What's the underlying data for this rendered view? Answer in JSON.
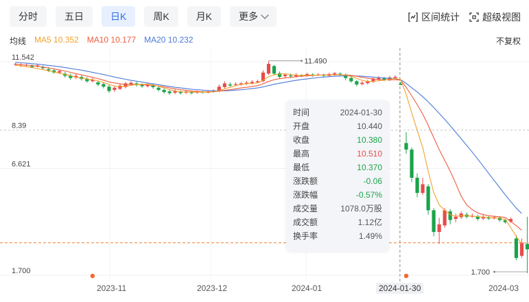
{
  "tabs": [
    {
      "label": "分时",
      "active": false
    },
    {
      "label": "五日",
      "active": false
    },
    {
      "label": "日K",
      "active": true
    },
    {
      "label": "周K",
      "active": false
    },
    {
      "label": "月K",
      "active": false
    },
    {
      "label": "更多",
      "active": false
    }
  ],
  "tools": {
    "range_stats": "区间统计",
    "super_view": "超级视图"
  },
  "indicators": {
    "title": "均线",
    "ma5": "MA5 10.352",
    "ma10": "MA10 10.177",
    "ma20": "MA20 10.232"
  },
  "adjust_label": "不复权",
  "tooltip": {
    "rows": [
      {
        "k": "时间",
        "v": "2024-01-30",
        "c": ""
      },
      {
        "k": "开盘",
        "v": "10.440",
        "c": ""
      },
      {
        "k": "收盘",
        "v": "10.380",
        "c": "g"
      },
      {
        "k": "最高",
        "v": "10.510",
        "c": "r"
      },
      {
        "k": "最低",
        "v": "10.370",
        "c": "g"
      },
      {
        "k": "涨跌额",
        "v": "-0.06",
        "c": "g"
      },
      {
        "k": "涨跌幅",
        "v": "-0.57%",
        "c": "g"
      },
      {
        "k": "成交量",
        "v": "1078.0万股",
        "c": ""
      },
      {
        "k": "成交额",
        "v": "1.12亿",
        "c": ""
      },
      {
        "k": "换手率",
        "v": "1.49%",
        "c": ""
      }
    ]
  },
  "x_axis": {
    "labels": [
      "2023-11",
      "2023-12",
      "2024-01",
      "2024-03"
    ],
    "highlight": "2024-01-30"
  },
  "colors": {
    "up": "#e84b4b",
    "down": "#1aa34a",
    "ma5": "#f0a22c",
    "ma10": "#ef5b3d",
    "ma20": "#4c78d8",
    "crosshair": "#f07b2c"
  },
  "chart_data": {
    "type": "candlestick",
    "y_ticks": [
      "11.542",
      "8.39",
      "6.621",
      "1.700"
    ],
    "ylim": [
      1.7,
      11.542
    ],
    "crosshair_price": "3.1",
    "annotations": {
      "high": "11.490",
      "low": "1.700"
    },
    "grid": true,
    "candles": [
      [
        11.32,
        11.35,
        11.4,
        11.25
      ],
      [
        11.3,
        11.32,
        11.38,
        11.2
      ],
      [
        11.28,
        11.3,
        11.36,
        11.22
      ],
      [
        11.25,
        11.2,
        11.32,
        11.15
      ],
      [
        11.22,
        11.28,
        11.35,
        11.18
      ],
      [
        11.2,
        11.15,
        11.28,
        11.1
      ],
      [
        11.1,
        11.05,
        11.2,
        10.98
      ],
      [
        11.05,
        10.95,
        11.12,
        10.9
      ],
      [
        10.95,
        11.02,
        11.08,
        10.88
      ],
      [
        10.9,
        10.8,
        10.98,
        10.72
      ],
      [
        10.82,
        10.7,
        10.9,
        10.62
      ],
      [
        10.72,
        10.8,
        10.88,
        10.65
      ],
      [
        10.75,
        10.65,
        10.82,
        10.58
      ],
      [
        10.66,
        10.55,
        10.74,
        10.48
      ],
      [
        10.55,
        10.62,
        10.7,
        10.5
      ],
      [
        10.5,
        10.4,
        10.58,
        10.32
      ],
      [
        10.42,
        10.3,
        10.5,
        10.22
      ],
      [
        10.3,
        10.1,
        10.38,
        10.02
      ],
      [
        10.15,
        10.25,
        10.32,
        10.05
      ],
      [
        10.2,
        10.35,
        10.42,
        10.15
      ],
      [
        10.28,
        10.45,
        10.52,
        10.22
      ],
      [
        10.4,
        10.48,
        10.55,
        10.35
      ],
      [
        10.45,
        10.38,
        10.52,
        10.3
      ],
      [
        10.38,
        10.32,
        10.45,
        10.25
      ],
      [
        10.32,
        10.4,
        10.48,
        10.26
      ],
      [
        10.35,
        10.28,
        10.42,
        10.2
      ],
      [
        10.25,
        10.15,
        10.32,
        10.08
      ],
      [
        10.15,
        10.05,
        10.22,
        9.98
      ],
      [
        10.08,
        10.0,
        10.15,
        9.92
      ],
      [
        10.02,
        10.1,
        10.18,
        9.95
      ],
      [
        10.05,
        10.0,
        10.12,
        9.94
      ],
      [
        10.02,
        10.08,
        10.15,
        9.96
      ],
      [
        10.05,
        10.0,
        10.12,
        9.95
      ],
      [
        10.02,
        10.06,
        10.12,
        9.97
      ],
      [
        10.05,
        10.02,
        10.1,
        9.98
      ],
      [
        10.02,
        10.08,
        10.14,
        9.99
      ],
      [
        10.08,
        10.12,
        10.18,
        10.02
      ],
      [
        10.1,
        10.3,
        10.4,
        10.05
      ],
      [
        10.28,
        10.45,
        10.55,
        10.22
      ],
      [
        10.4,
        10.35,
        10.5,
        10.3
      ],
      [
        10.38,
        10.42,
        10.5,
        10.33
      ],
      [
        10.4,
        10.45,
        10.52,
        10.35
      ],
      [
        10.42,
        10.48,
        10.56,
        10.38
      ],
      [
        10.46,
        10.52,
        10.6,
        10.4
      ],
      [
        10.5,
        10.55,
        10.62,
        10.45
      ],
      [
        10.55,
        10.95,
        11.05,
        10.5
      ],
      [
        10.9,
        11.35,
        11.49,
        10.85
      ],
      [
        11.25,
        10.9,
        11.3,
        10.82
      ],
      [
        10.92,
        10.75,
        11.0,
        10.68
      ],
      [
        10.78,
        10.85,
        10.92,
        10.7
      ],
      [
        10.82,
        10.78,
        10.9,
        10.7
      ],
      [
        10.78,
        10.85,
        10.92,
        10.72
      ],
      [
        10.82,
        10.8,
        10.88,
        10.74
      ],
      [
        10.8,
        10.88,
        10.94,
        10.76
      ],
      [
        10.86,
        10.82,
        10.92,
        10.76
      ],
      [
        10.82,
        10.86,
        10.92,
        10.78
      ],
      [
        10.84,
        10.8,
        10.9,
        10.74
      ],
      [
        10.8,
        10.88,
        10.94,
        10.76
      ],
      [
        10.86,
        10.92,
        10.98,
        10.8
      ],
      [
        10.9,
        10.85,
        10.96,
        10.8
      ],
      [
        10.86,
        10.7,
        10.9,
        10.6
      ],
      [
        10.7,
        10.55,
        10.75,
        10.48
      ],
      [
        10.55,
        10.4,
        10.6,
        10.32
      ],
      [
        10.42,
        10.48,
        10.55,
        10.36
      ],
      [
        10.46,
        10.55,
        10.62,
        10.4
      ],
      [
        10.52,
        10.65,
        10.72,
        10.48
      ],
      [
        10.62,
        10.7,
        10.78,
        10.56
      ],
      [
        10.68,
        10.6,
        10.75,
        10.55
      ],
      [
        10.6,
        10.72,
        10.8,
        10.56
      ],
      [
        10.7,
        10.75,
        10.82,
        10.66
      ],
      [
        10.44,
        10.38,
        10.51,
        10.37
      ],
      [
        7.7,
        7.4,
        8.2,
        7.2
      ],
      [
        7.4,
        6.1,
        7.5,
        5.9
      ],
      [
        6.1,
        5.4,
        6.3,
        5.2
      ],
      [
        5.4,
        5.8,
        6.1,
        5.3
      ],
      [
        5.7,
        4.6,
        5.8,
        4.4
      ],
      [
        4.6,
        3.6,
        4.7,
        3.4
      ],
      [
        3.6,
        3.95,
        4.25,
        3.05
      ],
      [
        3.9,
        4.6,
        4.7,
        3.8
      ],
      [
        4.55,
        4.15,
        4.65,
        3.95
      ],
      [
        4.2,
        4.3,
        4.45,
        4.05
      ],
      [
        4.28,
        4.45,
        4.55,
        4.2
      ],
      [
        4.4,
        4.3,
        4.5,
        4.22
      ],
      [
        4.3,
        4.35,
        4.45,
        4.25
      ],
      [
        4.32,
        4.2,
        4.4,
        4.12
      ],
      [
        4.22,
        4.3,
        4.38,
        4.15
      ],
      [
        4.28,
        4.22,
        4.35,
        4.15
      ],
      [
        4.22,
        4.28,
        4.35,
        4.18
      ],
      [
        4.26,
        4.15,
        4.32,
        4.08
      ],
      [
        4.15,
        4.05,
        4.22,
        3.98
      ],
      [
        4.08,
        4.2,
        4.26,
        4.02
      ],
      [
        3.3,
        2.4,
        3.45,
        2.3
      ],
      [
        2.5,
        3.1,
        3.3,
        2.4
      ],
      [
        3.05,
        2.8,
        4.3,
        1.7
      ]
    ],
    "ma5": [
      11.29,
      11.26,
      11.22,
      11.18,
      11.13,
      11.08,
      11.03,
      10.98,
      10.92,
      10.87,
      10.8,
      10.74,
      10.69,
      10.66,
      10.62,
      10.56,
      10.5,
      10.4,
      10.33,
      10.3,
      10.31,
      10.36,
      10.4,
      10.41,
      10.41,
      10.38,
      10.32,
      10.24,
      10.16,
      10.1,
      10.07,
      10.05,
      10.05,
      10.05,
      10.04,
      10.05,
      10.06,
      10.11,
      10.2,
      10.27,
      10.34,
      10.4,
      10.43,
      10.45,
      10.47,
      10.59,
      10.76,
      10.85,
      10.88,
      10.89,
      10.86,
      10.83,
      10.82,
      10.83,
      10.83,
      10.83,
      10.83,
      10.84,
      10.85,
      10.86,
      10.83,
      10.77,
      10.68,
      10.59,
      10.54,
      10.55,
      10.57,
      10.6,
      10.64,
      10.68,
      10.63,
      9.94,
      9.1,
      8.28,
      7.5,
      6.4,
      5.42,
      4.85,
      4.6,
      4.4,
      4.32,
      4.35,
      4.35,
      4.33,
      4.31,
      4.29,
      4.27,
      4.25,
      4.23,
      4.18,
      3.8,
      3.4,
      3.05
    ],
    "ma10": [
      11.33,
      11.31,
      11.29,
      11.27,
      11.24,
      11.2,
      11.16,
      11.12,
      11.07,
      11.02,
      10.96,
      10.9,
      10.84,
      10.79,
      10.73,
      10.67,
      10.6,
      10.52,
      10.47,
      10.43,
      10.4,
      10.4,
      10.4,
      10.39,
      10.38,
      10.36,
      10.33,
      10.29,
      10.24,
      10.2,
      10.16,
      10.13,
      10.1,
      10.08,
      10.06,
      10.06,
      10.07,
      10.09,
      10.13,
      10.16,
      10.2,
      10.24,
      10.27,
      10.31,
      10.35,
      10.43,
      10.54,
      10.62,
      10.67,
      10.7,
      10.73,
      10.76,
      10.78,
      10.8,
      10.81,
      10.83,
      10.84,
      10.85,
      10.85,
      10.85,
      10.84,
      10.82,
      10.78,
      10.73,
      10.69,
      10.66,
      10.63,
      10.61,
      10.61,
      10.62,
      10.6,
      10.27,
      9.88,
      9.47,
      9.04,
      8.52,
      7.95,
      7.4,
      6.9,
      6.4,
      5.84,
      5.24,
      4.85,
      4.63,
      4.48,
      4.4,
      4.35,
      4.32,
      4.3,
      4.27,
      4.09,
      3.89,
      3.68
    ],
    "ma20": [
      11.42,
      11.4,
      11.38,
      11.36,
      11.34,
      11.31,
      11.28,
      11.25,
      11.22,
      11.18,
      11.14,
      11.1,
      11.06,
      11.01,
      10.96,
      10.91,
      10.86,
      10.8,
      10.74,
      10.69,
      10.64,
      10.59,
      10.55,
      10.51,
      10.47,
      10.43,
      10.39,
      10.35,
      10.31,
      10.27,
      10.24,
      10.21,
      10.18,
      10.16,
      10.14,
      10.12,
      10.11,
      10.11,
      10.11,
      10.12,
      10.14,
      10.16,
      10.18,
      10.21,
      10.24,
      10.29,
      10.35,
      10.41,
      10.46,
      10.5,
      10.55,
      10.59,
      10.63,
      10.66,
      10.69,
      10.72,
      10.74,
      10.76,
      10.78,
      10.79,
      10.8,
      10.8,
      10.79,
      10.78,
      10.76,
      10.74,
      10.72,
      10.7,
      10.68,
      10.67,
      10.62,
      10.45,
      10.25,
      10.05,
      9.84,
      9.6,
      9.34,
      9.07,
      8.79,
      8.5,
      8.2,
      7.9,
      7.59,
      7.28,
      6.96,
      6.63,
      6.3,
      5.97,
      5.64,
      5.31,
      5.0,
      4.7,
      4.45
    ]
  }
}
